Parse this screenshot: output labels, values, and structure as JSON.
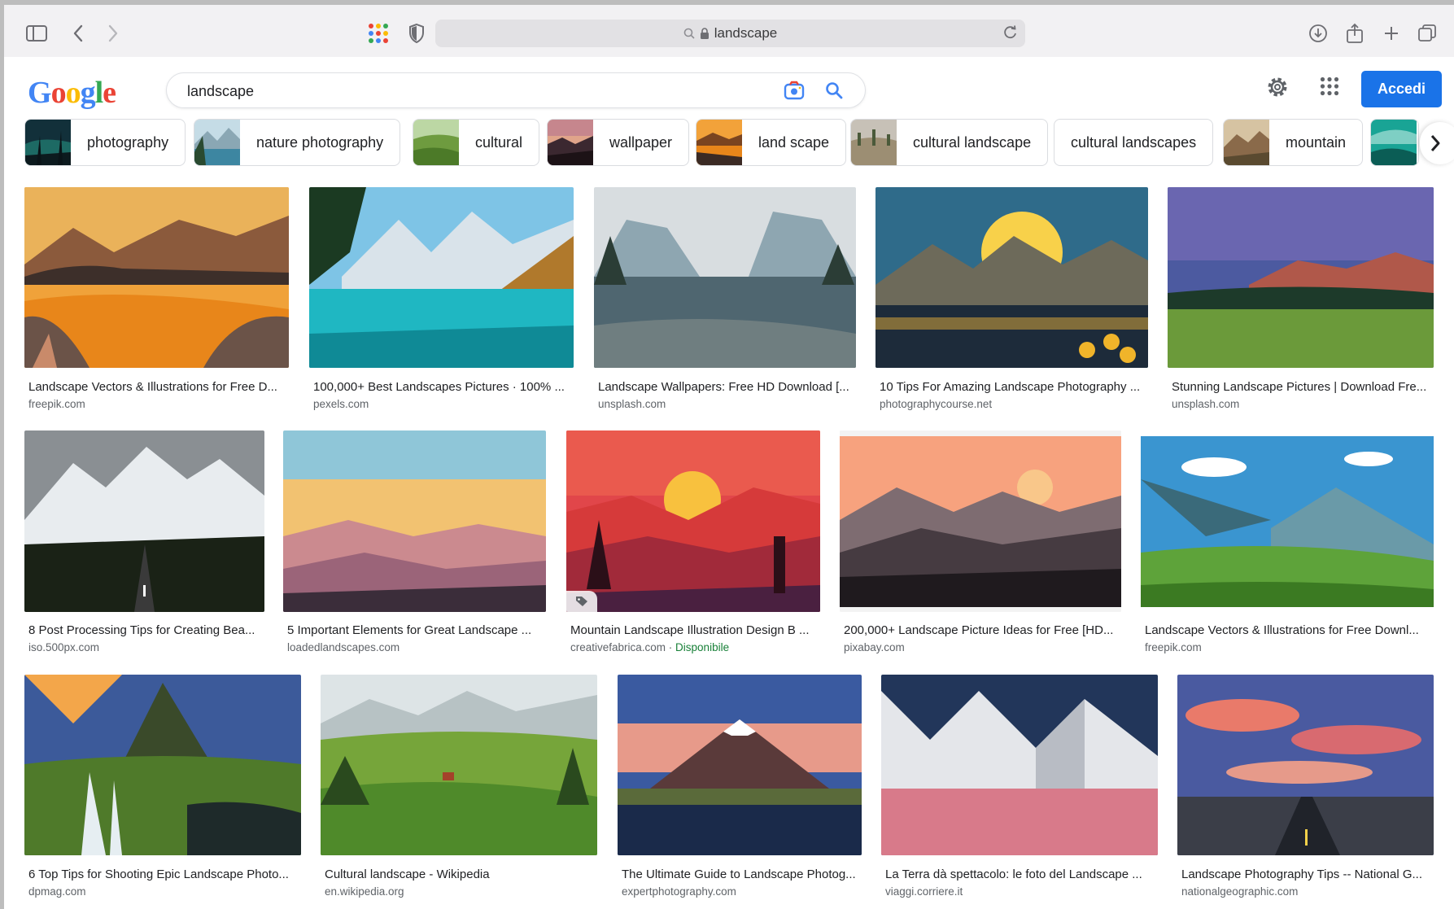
{
  "browser": {
    "url_text": "landscape"
  },
  "google": {
    "search_value": "landscape",
    "signin_label": "Accedi"
  },
  "chips": [
    {
      "label": "photography"
    },
    {
      "label": "nature photography"
    },
    {
      "label": "cultural"
    },
    {
      "label": "wallpaper"
    },
    {
      "label": "land scape"
    },
    {
      "label": "cultural landscape"
    },
    {
      "label": "cultural landscapes"
    },
    {
      "label": "mountain"
    }
  ],
  "results": [
    {
      "title": "Landscape Vectors & Illustrations for Free D...",
      "source": "freepik.com"
    },
    {
      "title": "100,000+ Best Landscapes Pictures · 100% ...",
      "source": "pexels.com"
    },
    {
      "title": "Landscape Wallpapers: Free HD Download [...",
      "source": "unsplash.com"
    },
    {
      "title": "10 Tips For Amazing Landscape Photography ...",
      "source": "photographycourse.net"
    },
    {
      "title": "Stunning Landscape Pictures | Download Fre...",
      "source": "unsplash.com"
    },
    {
      "title": "8 Post Processing Tips for Creating Bea...",
      "source": "iso.500px.com"
    },
    {
      "title": "5 Important Elements for Great Landscape ...",
      "source": "loadedlandscapes.com"
    },
    {
      "title": "Mountain Landscape Illustration Design B ...",
      "source": "creativefabrica.com",
      "sep": " · ",
      "availability": "Disponibile"
    },
    {
      "title": "200,000+ Landscape Picture Ideas for Free [HD...",
      "source": "pixabay.com"
    },
    {
      "title": "Landscape Vectors & Illustrations for Free Downl...",
      "source": "freepik.com"
    },
    {
      "title": "6 Top Tips for Shooting Epic Landscape Photo...",
      "source": "dpmag.com"
    },
    {
      "title": "Cultural landscape - Wikipedia",
      "source": "en.wikipedia.org"
    },
    {
      "title": "The Ultimate Guide to Landscape Photog...",
      "source": "expertphotography.com"
    },
    {
      "title": "La Terra dà spettacolo: le foto del Landscape ...",
      "source": "viaggi.corriere.it"
    },
    {
      "title": "Landscape Photography Tips -- National G...",
      "source": "nationalgeographic.com"
    }
  ],
  "colors": {
    "accent_blue": "#1a73e8",
    "available_green": "#188038"
  }
}
